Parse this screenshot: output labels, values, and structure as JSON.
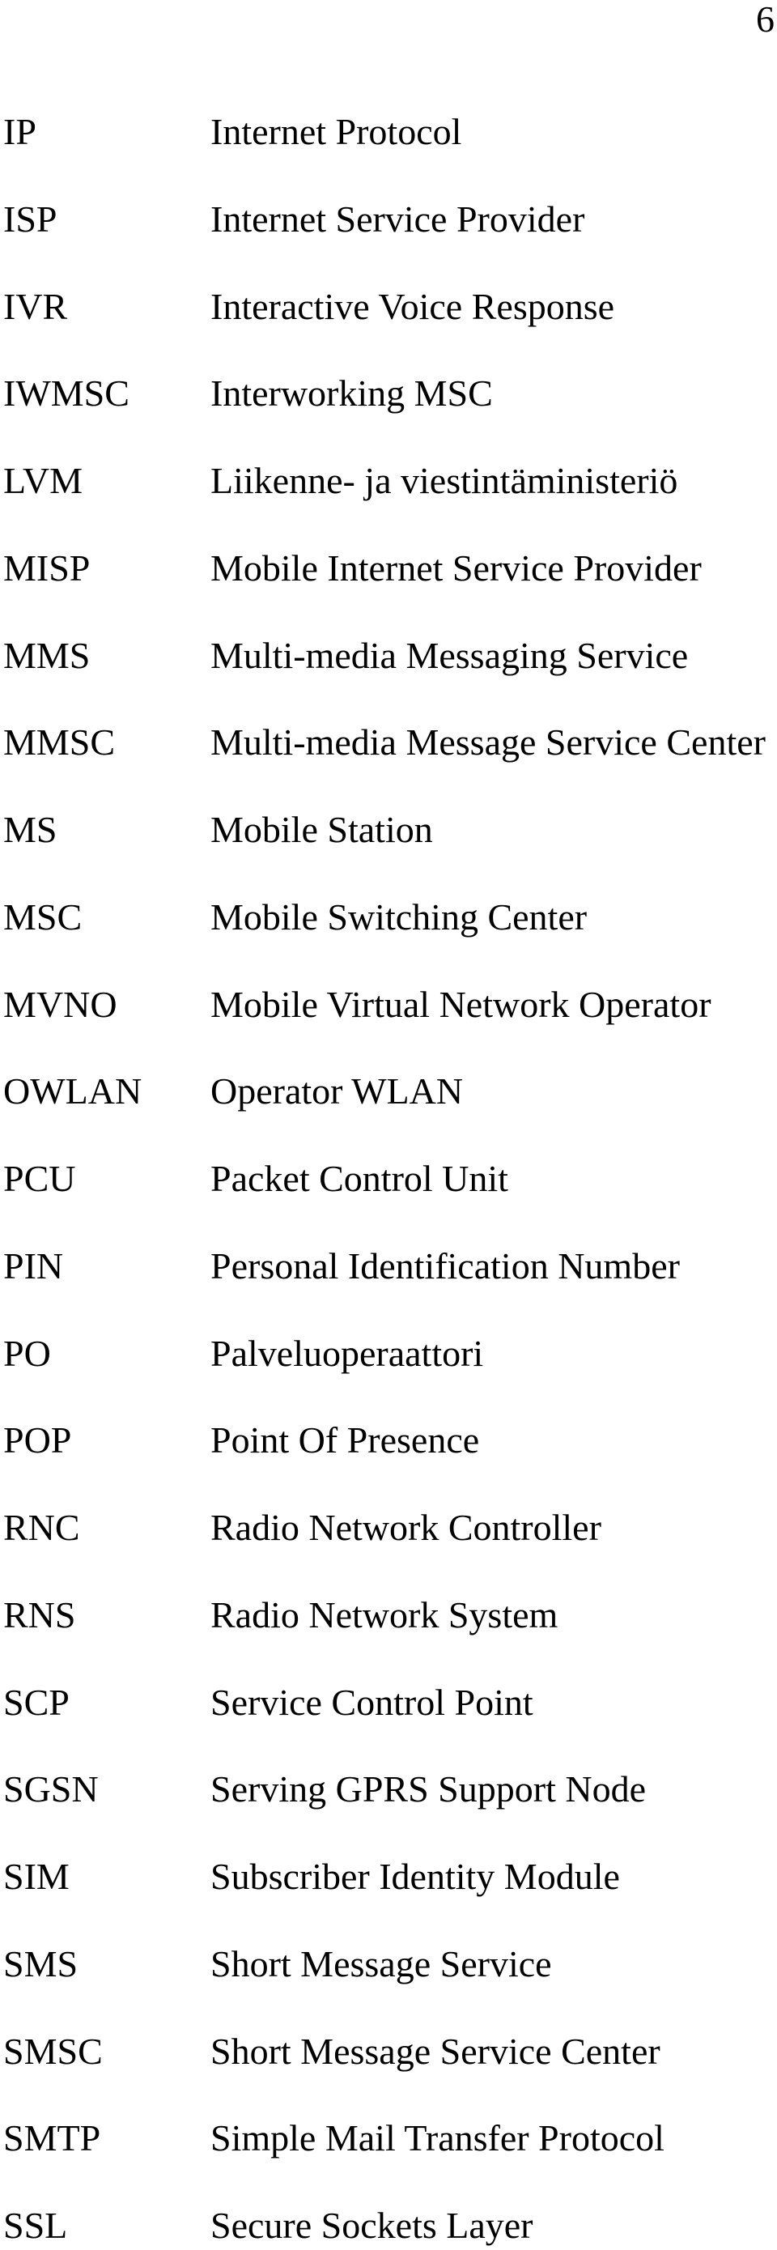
{
  "page": {
    "number": "6"
  },
  "abbreviations": [
    {
      "term": "IP",
      "definition": "Internet Protocol"
    },
    {
      "term": "ISP",
      "definition": "Internet Service Provider"
    },
    {
      "term": "IVR",
      "definition": "Interactive Voice Response"
    },
    {
      "term": "IWMSC",
      "definition": "Interworking MSC"
    },
    {
      "term": "LVM",
      "definition": "Liikenne- ja viestintäministeriö"
    },
    {
      "term": "MISP",
      "definition": "Mobile Internet Service Provider"
    },
    {
      "term": "MMS",
      "definition": "Multi-media Messaging Service"
    },
    {
      "term": "MMSC",
      "definition": "Multi-media Message Service Center"
    },
    {
      "term": "MS",
      "definition": "Mobile Station"
    },
    {
      "term": "MSC",
      "definition": "Mobile Switching Center"
    },
    {
      "term": "MVNO",
      "definition": "Mobile Virtual Network Operator"
    },
    {
      "term": "OWLAN",
      "definition": "Operator WLAN"
    },
    {
      "term": "PCU",
      "definition": "Packet Control Unit"
    },
    {
      "term": "PIN",
      "definition": "Personal Identification Number"
    },
    {
      "term": "PO",
      "definition": "Palveluoperaattori"
    },
    {
      "term": "POP",
      "definition": "Point Of Presence"
    },
    {
      "term": "RNC",
      "definition": "Radio Network Controller"
    },
    {
      "term": "RNS",
      "definition": "Radio Network System"
    },
    {
      "term": "SCP",
      "definition": "Service Control Point"
    },
    {
      "term": "SGSN",
      "definition": "Serving GPRS Support Node"
    },
    {
      "term": "SIM",
      "definition": "Subscriber Identity Module"
    },
    {
      "term": "SMS",
      "definition": "Short Message Service"
    },
    {
      "term": "SMSC",
      "definition": "Short Message Service Center"
    },
    {
      "term": "SMTP",
      "definition": "Simple Mail Transfer Protocol"
    },
    {
      "term": "SSL",
      "definition": "Secure Sockets Layer"
    }
  ]
}
